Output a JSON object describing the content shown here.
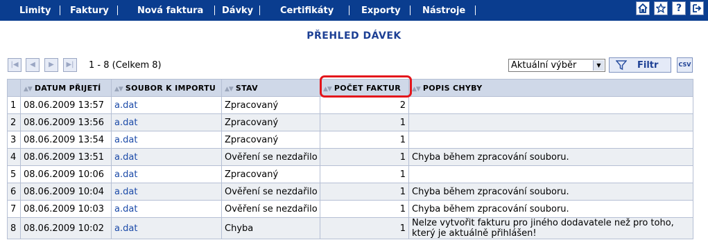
{
  "nav": {
    "items": [
      "Limity",
      "Faktury",
      "Nová faktura",
      "Dávky",
      "Certifikáty",
      "Exporty",
      "Nástroje"
    ],
    "icons": [
      "home-icon",
      "star-icon",
      "help-icon",
      "logout-icon"
    ],
    "help_glyph": "?"
  },
  "page": {
    "title": "PŘEHLED DÁVEK"
  },
  "pager": {
    "info": "1 - 8 (Celkem 8)"
  },
  "filter": {
    "selected": "Aktuální výběr",
    "button_label": "Filtr",
    "csv_label": "CSV"
  },
  "table": {
    "columns": [
      "DATUM PŘIJETÍ",
      "SOUBOR K IMPORTU",
      "STAV",
      "POČET FAKTUR",
      "POPIS CHYBY"
    ],
    "rows": [
      [
        "1",
        "08.06.2009 13:57",
        "a.dat",
        "Zpracovaný",
        "2",
        ""
      ],
      [
        "2",
        "08.06.2009 13:56",
        "a.dat",
        "Zpracovaný",
        "1",
        ""
      ],
      [
        "3",
        "08.06.2009 13:54",
        "a.dat",
        "Zpracovaný",
        "1",
        ""
      ],
      [
        "4",
        "08.06.2009 13:51",
        "a.dat",
        "Ověření se nezdařilo",
        "1",
        "Chyba během zpracování souboru."
      ],
      [
        "5",
        "08.06.2009 10:06",
        "a.dat",
        "Zpracovaný",
        "1",
        ""
      ],
      [
        "6",
        "08.06.2009 10:04",
        "a.dat",
        "Ověření se nezdařilo",
        "1",
        "Chyba během zpracování souboru."
      ],
      [
        "7",
        "08.06.2009 10:03",
        "a.dat",
        "Ověření se nezdařilo",
        "1",
        "Chyba během zpracování souboru."
      ],
      [
        "8",
        "08.06.2009 10:02",
        "a.dat",
        "Chyba",
        "1",
        "Nelze vytvořit fakturu pro jiného dodavatele než pro toho, který je aktuálně přihlášen!"
      ]
    ]
  },
  "colors": {
    "navbar": "#0a3d8f",
    "title": "#1c3f94",
    "highlight": "#e3151b",
    "header_bg": "#cfd8e8"
  }
}
